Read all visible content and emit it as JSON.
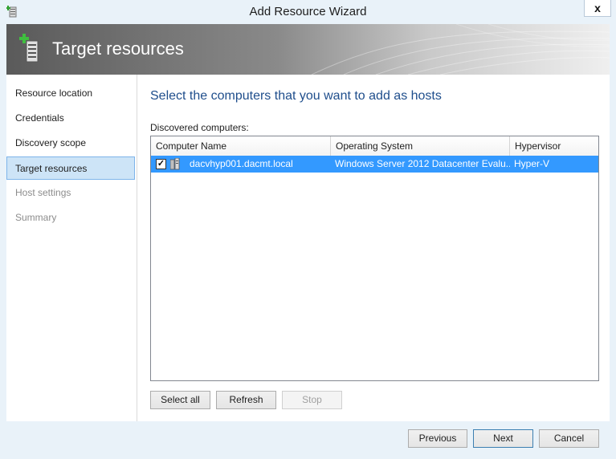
{
  "window": {
    "title": "Add Resource Wizard",
    "close_glyph": "x"
  },
  "banner": {
    "title": "Target resources",
    "icon": "add-host-icon"
  },
  "nav": {
    "items": [
      {
        "label": "Resource location",
        "state": "normal"
      },
      {
        "label": "Credentials",
        "state": "normal"
      },
      {
        "label": "Discovery scope",
        "state": "normal"
      },
      {
        "label": "Target resources",
        "state": "active"
      },
      {
        "label": "Host settings",
        "state": "disabled"
      },
      {
        "label": "Summary",
        "state": "disabled"
      }
    ]
  },
  "main": {
    "heading": "Select the computers that you want to add as hosts",
    "list_label": "Discovered computers:",
    "columns": [
      "Computer Name",
      "Operating System",
      "Hypervisor"
    ],
    "rows": [
      {
        "checked": true,
        "computer_name": "dacvhyp001.dacmt.local",
        "os": "Windows Server 2012 Datacenter Evalu...",
        "hypervisor": "Hyper-V",
        "icon": "server-icon"
      }
    ],
    "buttons": {
      "select_all": "Select all",
      "refresh": "Refresh",
      "stop": "Stop"
    }
  },
  "footer": {
    "previous": "Previous",
    "next": "Next",
    "cancel": "Cancel"
  },
  "colors": {
    "selection": "#3399ff",
    "heading": "#1f4e8c",
    "nav_active": "#cde4f7"
  }
}
